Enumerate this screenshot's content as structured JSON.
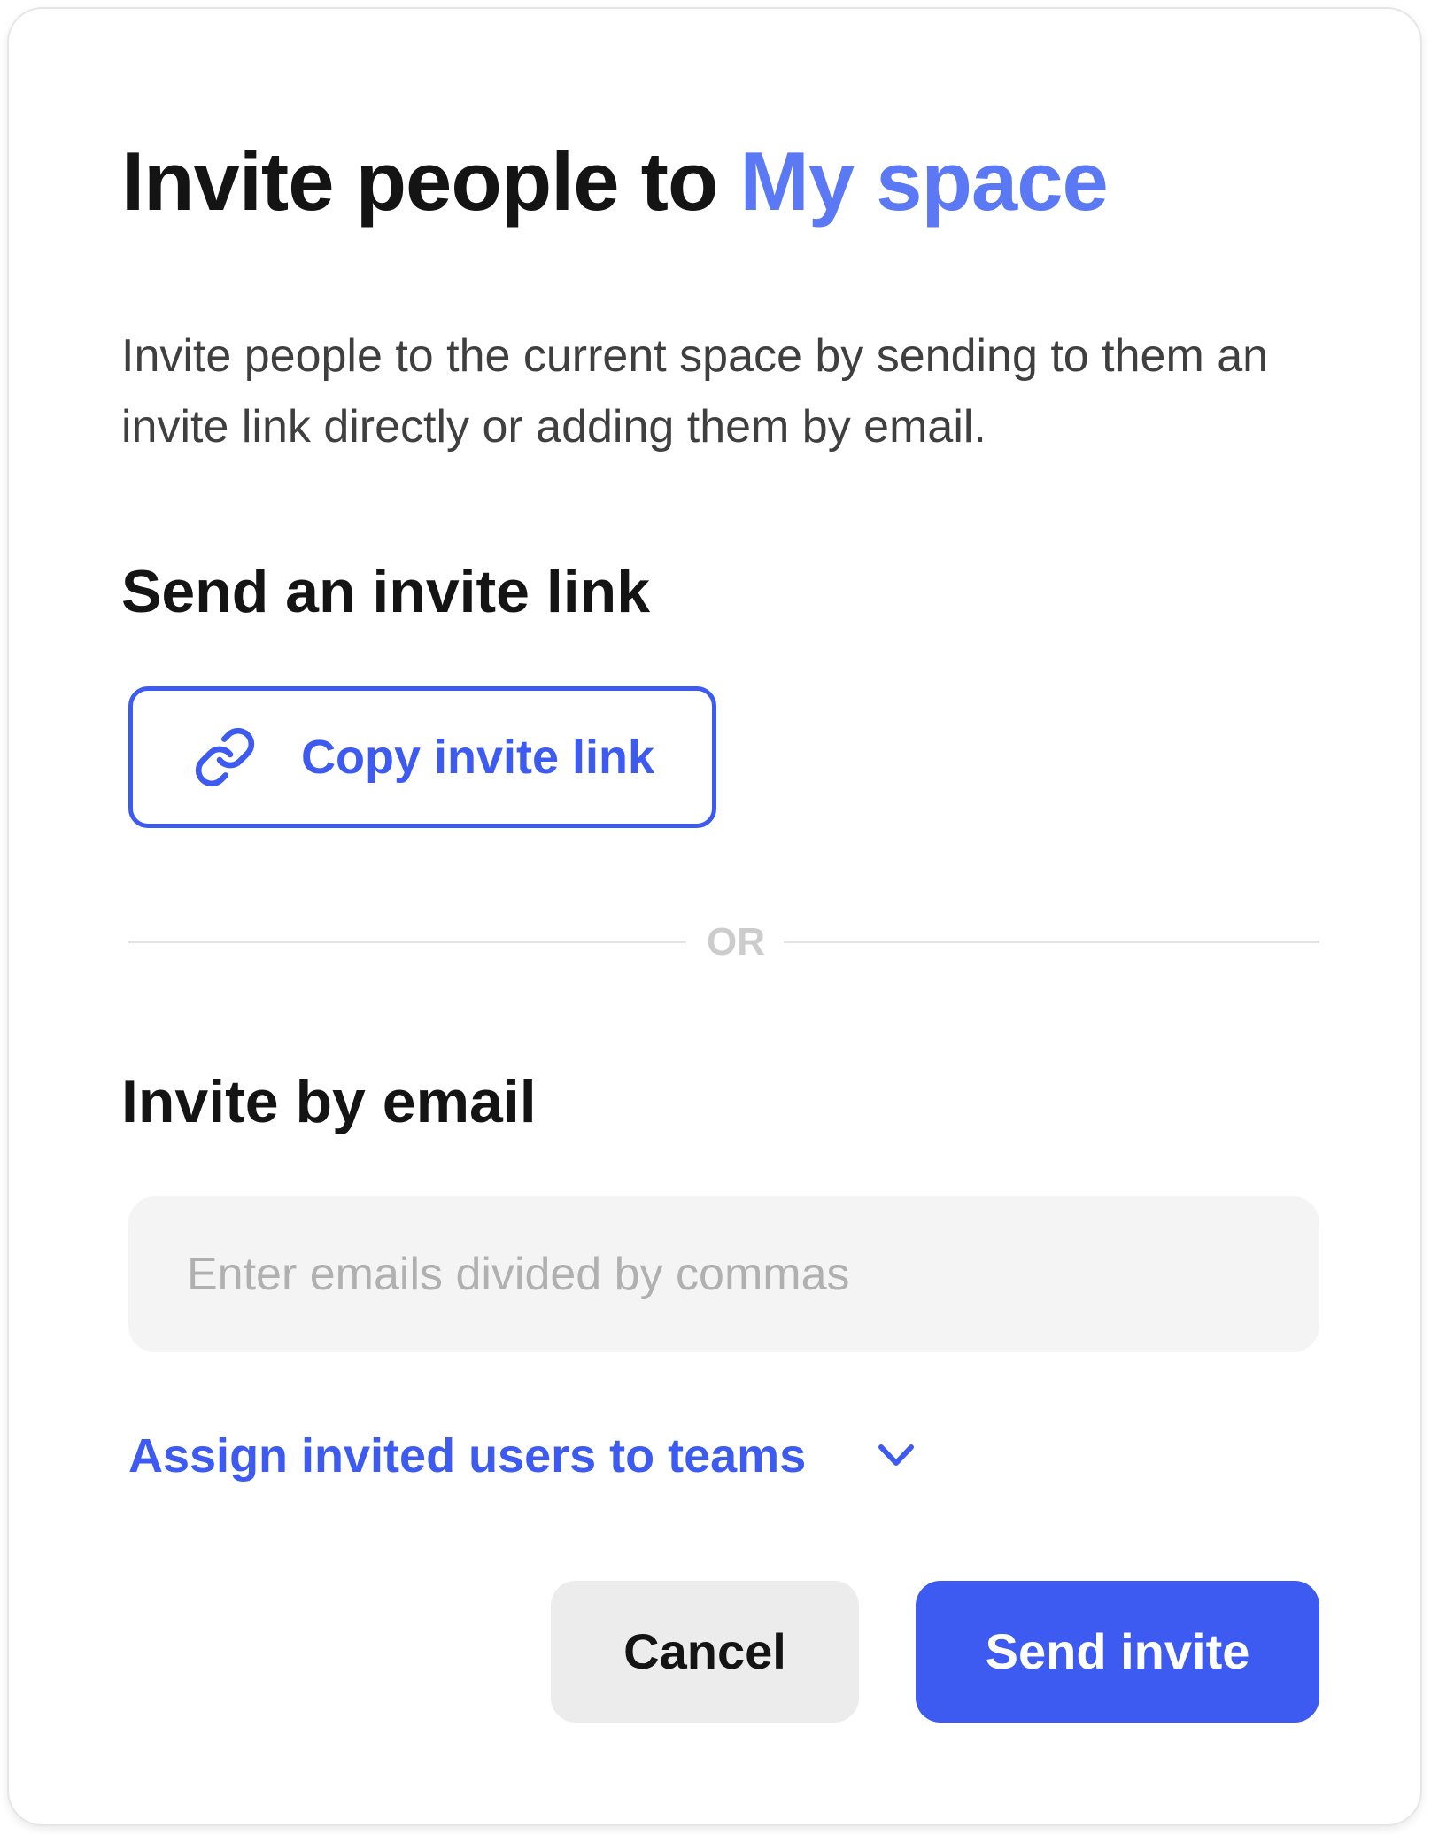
{
  "dialog": {
    "title_prefix": "Invite people to",
    "space_name": "My space",
    "description": "Invite people to the current space by sending to them an invite link directly or adding them by email."
  },
  "invite_link": {
    "heading": "Send an invite link",
    "copy_button_label": "Copy invite link",
    "icon": "link-icon"
  },
  "divider": {
    "label": "OR"
  },
  "invite_email": {
    "heading": "Invite by email",
    "input_value": "",
    "input_placeholder": "Enter emails divided by commas",
    "assign_teams_label": "Assign invited users to teams",
    "assign_teams_icon": "chevron-down-icon"
  },
  "actions": {
    "cancel_label": "Cancel",
    "send_label": "Send invite"
  },
  "colors": {
    "accent": "#3d5af1",
    "space_name": "#5b78f5",
    "text_primary": "#141414",
    "text_secondary": "#3f3f3f",
    "input_background": "#f4f4f4",
    "cancel_background": "#ececec",
    "divider_text": "#cccccc"
  }
}
